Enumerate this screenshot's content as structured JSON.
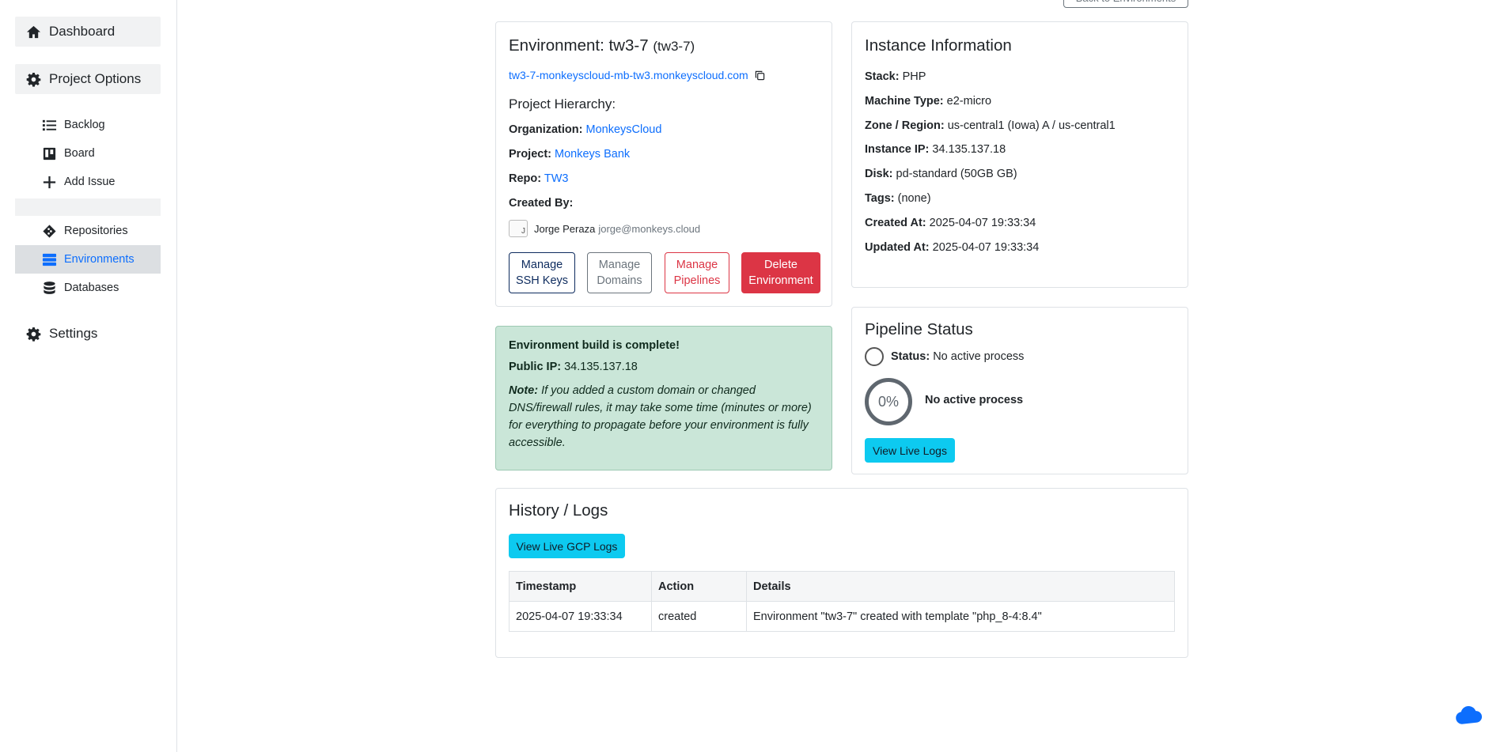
{
  "sidebar": {
    "dashboard": "Dashboard",
    "project_options": "Project Options",
    "items": [
      {
        "label": "Backlog"
      },
      {
        "label": "Board"
      },
      {
        "label": "Add Issue"
      },
      {
        "label": "Repositories"
      },
      {
        "label": "Environments"
      },
      {
        "label": "Databases"
      }
    ],
    "settings": "Settings"
  },
  "header": {
    "back_button": "Back to Environments"
  },
  "environment": {
    "title_prefix": "Environment: tw3-7",
    "title_suffix": "(tw3-7)",
    "url": "tw3-7-monkeyscloud-mb-tw3.monkeyscloud.com",
    "hierarchy_title": "Project Hierarchy:",
    "organization_label": "Organization:",
    "organization": "MonkeysCloud",
    "project_label": "Project:",
    "project": "Monkeys Bank",
    "repo_label": "Repo:",
    "repo": "TW3",
    "created_by_label": "Created By:",
    "creator_avatar_alt": "J",
    "creator_name": "Jorge Peraza",
    "creator_email": "jorge@monkeys.cloud",
    "buttons": {
      "ssh": "Manage SSH Keys",
      "domains": "Manage Domains",
      "pipelines": "Manage Pipelines",
      "delete": "Delete Environment"
    }
  },
  "alert": {
    "title": "Environment build is complete!",
    "public_ip_label": "Public IP:",
    "public_ip": "34.135.137.18",
    "note_label": "Note:",
    "note_text": "If you added a custom domain or changed DNS/firewall rules, it may take some time (minutes or more) for everything to propagate before your environment is fully accessible."
  },
  "instance": {
    "title": "Instance Information",
    "rows": [
      {
        "label": "Stack:",
        "value": "PHP"
      },
      {
        "label": "Machine Type:",
        "value": "e2-micro"
      },
      {
        "label": "Zone / Region:",
        "value": "us-central1 (Iowa) A / us-central1"
      },
      {
        "label": "Instance IP:",
        "value": "34.135.137.18"
      },
      {
        "label": "Disk:",
        "value": "pd-standard (50GB GB)"
      },
      {
        "label": "Tags:",
        "value": "(none)"
      },
      {
        "label": "Created At:",
        "value": "2025-04-07 19:33:34"
      },
      {
        "label": "Updated At:",
        "value": "2025-04-07 19:33:34"
      }
    ]
  },
  "pipeline": {
    "title": "Pipeline Status",
    "status_label": "Status:",
    "status_value": "No active process",
    "progress_text": "0%",
    "progress_value": 0,
    "progress_caption": "No active process",
    "live_logs_button": "View Live Logs"
  },
  "history": {
    "title": "History / Logs",
    "gcp_button": "View Live GCP Logs",
    "columns": [
      "Timestamp",
      "Action",
      "Details"
    ],
    "rows": [
      [
        "2025-04-07 19:33:34",
        "created",
        "Environment \"tw3-7\" created with template \"php_8-4:8.4\""
      ]
    ]
  },
  "colors": {
    "accent": "#0d6efd",
    "danger": "#dc3545",
    "info": "#0dcaf0",
    "success_bg": "#cae6d8"
  }
}
